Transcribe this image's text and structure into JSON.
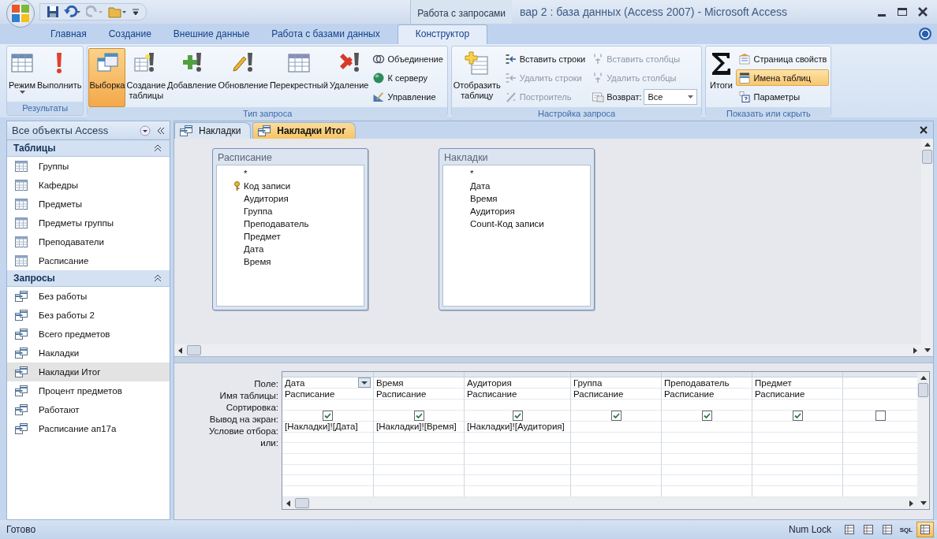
{
  "title_bar": {
    "context_tab": "Работа с запросами",
    "title": "вар 2 : база данных (Access 2007) - Microsoft Access"
  },
  "ribbon_tabs": [
    {
      "label": "Главная",
      "selected": false
    },
    {
      "label": "Создание",
      "selected": false
    },
    {
      "label": "Внешние данные",
      "selected": false
    },
    {
      "label": "Работа с базами данных",
      "selected": false
    },
    {
      "label": "Конструктор",
      "selected": true
    }
  ],
  "ribbon_groups": [
    {
      "label": "Результаты",
      "items": [
        {
          "kind": "large",
          "label": "Режим",
          "menu": true,
          "selected": false
        },
        {
          "kind": "large",
          "label": "Выполнить",
          "selected": false
        }
      ]
    },
    {
      "label": "Тип запроса",
      "items": [
        {
          "kind": "large",
          "label": "Выборка",
          "selected": true
        },
        {
          "kind": "large",
          "label": "Создание\nтаблицы",
          "selected": false
        },
        {
          "kind": "large",
          "label": "Добавление",
          "selected": false
        },
        {
          "kind": "large",
          "label": "Обновление",
          "selected": false
        },
        {
          "kind": "large",
          "label": "Перекрестный",
          "selected": false
        },
        {
          "kind": "large",
          "label": "Удаление",
          "selected": false
        },
        {
          "kind": "stack",
          "items": [
            {
              "kind": "small",
              "label": "Объединение",
              "disabled": false,
              "selected": false
            },
            {
              "kind": "small",
              "label": "К серверу",
              "disabled": false,
              "selected": false
            },
            {
              "kind": "small",
              "label": "Управление",
              "disabled": false,
              "selected": false
            }
          ]
        }
      ]
    },
    {
      "label": "Настройка запроса",
      "items": [
        {
          "kind": "large",
          "label": "Отобразить\nтаблицу",
          "selected": false
        },
        {
          "kind": "stack",
          "items": [
            {
              "kind": "small",
              "label": "Вставить строки",
              "disabled": false,
              "selected": false
            },
            {
              "kind": "small",
              "label": "Удалить строки",
              "disabled": true,
              "selected": false
            },
            {
              "kind": "small",
              "label": "Построитель",
              "disabled": true,
              "selected": false
            }
          ]
        },
        {
          "kind": "stack",
          "items": [
            {
              "kind": "small",
              "label": "Вставить столбцы",
              "disabled": true,
              "selected": false
            },
            {
              "kind": "small",
              "label": "Удалить столбцы",
              "disabled": true,
              "selected": false
            },
            {
              "kind": "select",
              "label": "Возврат:",
              "value": "Все"
            }
          ]
        }
      ]
    },
    {
      "label": "Показать или скрыть",
      "items": [
        {
          "kind": "large",
          "label": "Итоги",
          "selected": false
        },
        {
          "kind": "stack",
          "items": [
            {
              "kind": "small",
              "label": "Страница свойств",
              "disabled": false,
              "selected": false
            },
            {
              "kind": "small",
              "label": "Имена таблиц",
              "disabled": false,
              "selected": true
            },
            {
              "kind": "small",
              "label": "Параметры",
              "disabled": false,
              "selected": false
            }
          ]
        }
      ]
    }
  ],
  "nav_pane": {
    "title": "Все объекты Access",
    "groups": [
      {
        "label": "Таблицы",
        "kind": "tables",
        "items": [
          {
            "label": "Группы",
            "selected": false
          },
          {
            "label": "Кафедры",
            "selected": false
          },
          {
            "label": "Предметы",
            "selected": false
          },
          {
            "label": "Предметы группы",
            "selected": false
          },
          {
            "label": "Преподаватели",
            "selected": false
          },
          {
            "label": "Расписание",
            "selected": false
          }
        ]
      },
      {
        "label": "Запросы",
        "kind": "queries",
        "items": [
          {
            "label": "Без работы",
            "selected": false
          },
          {
            "label": "Без работы 2",
            "selected": false
          },
          {
            "label": "Всего предметов",
            "selected": false
          },
          {
            "label": "Накладки",
            "selected": false
          },
          {
            "label": "Накладки Итог",
            "selected": true
          },
          {
            "label": "Процент предметов",
            "selected": false
          },
          {
            "label": "Работают",
            "selected": false
          },
          {
            "label": "Расписание ап17а",
            "selected": false
          }
        ]
      }
    ]
  },
  "document_tabs": [
    {
      "label": "Накладки",
      "selected": false
    },
    {
      "label": "Накладки Итог",
      "selected": true
    }
  ],
  "tables": [
    {
      "title": "Расписание",
      "fields": [
        {
          "label": "*",
          "key": false
        },
        {
          "label": "Код записи",
          "key": true
        },
        {
          "label": "Аудитория",
          "key": false
        },
        {
          "label": "Группа",
          "key": false
        },
        {
          "label": "Преподаватель",
          "key": false
        },
        {
          "label": "Предмет",
          "key": false
        },
        {
          "label": "Дата",
          "key": false
        },
        {
          "label": "Время",
          "key": false
        }
      ]
    },
    {
      "title": "Накладки",
      "fields": [
        {
          "label": "*",
          "key": false
        },
        {
          "label": "Дата",
          "key": false
        },
        {
          "label": "Время",
          "key": false
        },
        {
          "label": "Аудитория",
          "key": false
        },
        {
          "label": "Count-Код записи",
          "key": false
        }
      ]
    }
  ],
  "design_grid": {
    "row_labels": [
      "Поле:",
      "Имя таблицы:",
      "Сортировка:",
      "Вывод на экран:",
      "Условие отбора:",
      "или:"
    ],
    "columns": [
      {
        "field": "Дата",
        "table": "Расписание",
        "show": true,
        "criteria": "[Накладки]![Дата]",
        "dropdown": true
      },
      {
        "field": "Время",
        "table": "Расписание",
        "show": true,
        "criteria": "[Накладки]![Время]",
        "dropdown": false
      },
      {
        "field": "Аудитория",
        "table": "Расписание",
        "show": true,
        "criteria": "[Накладки]![Аудитория]",
        "dropdown": false
      },
      {
        "field": "Группа",
        "table": "Расписание",
        "show": true,
        "dropdown": false
      },
      {
        "field": "Преподаватель",
        "table": "Расписание",
        "show": true,
        "dropdown": false
      },
      {
        "field": "Предмет",
        "table": "Расписание",
        "show": true,
        "dropdown": false
      },
      {
        "show": false,
        "dropdown": false
      }
    ]
  },
  "status_bar": {
    "text": "Готово",
    "indicator": "Num Lock",
    "views": [
      {
        "kind": "icon",
        "selected": false
      },
      {
        "kind": "icon",
        "selected": false
      },
      {
        "kind": "icon",
        "selected": false
      },
      {
        "kind": "text",
        "label": "SQL",
        "selected": false
      },
      {
        "kind": "icon",
        "selected": true
      }
    ]
  }
}
